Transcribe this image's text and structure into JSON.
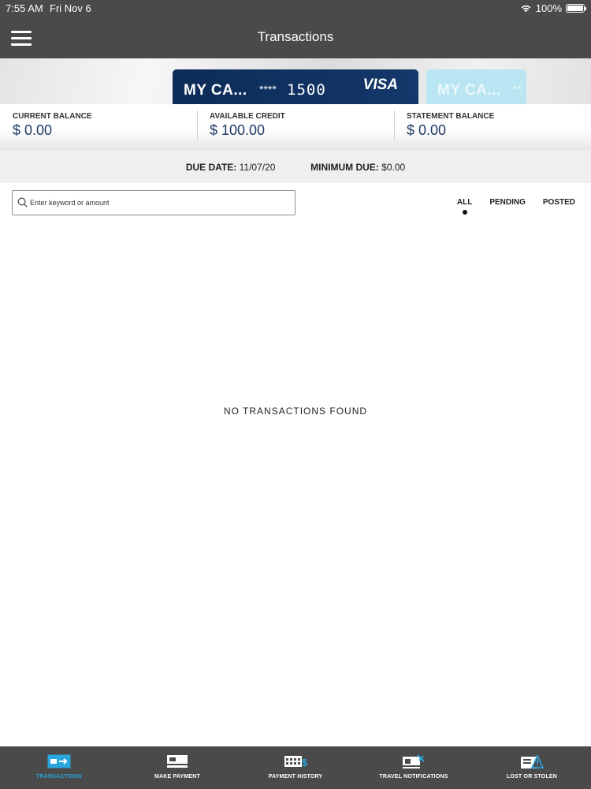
{
  "status_bar": {
    "time": "7:55 AM",
    "date": "Fri Nov 6",
    "battery": "100%"
  },
  "header": {
    "title": "Transactions"
  },
  "cards": [
    {
      "name": "MY CA...",
      "masked": "****",
      "last4": "1500",
      "brand": "VISA"
    },
    {
      "name": "MY CA...",
      "masked": "**"
    }
  ],
  "balances": [
    {
      "label": "CURRENT BALANCE",
      "value": "$ 0.00"
    },
    {
      "label": "AVAILABLE CREDIT",
      "value": "$ 100.00"
    },
    {
      "label": "STATEMENT BALANCE",
      "value": "$ 0.00"
    }
  ],
  "due": {
    "date_label": "DUE DATE:",
    "date_value": "11/07/20",
    "min_label": "MINIMUM DUE:",
    "min_value": "$0.00"
  },
  "search": {
    "placeholder": "Enter keyword or amount"
  },
  "filters": [
    "ALL",
    "PENDING",
    "POSTED"
  ],
  "empty_message": "NO TRANSACTIONS FOUND",
  "bottom_nav": [
    {
      "label": "TRANSACTIONS",
      "icon": "transactions-icon"
    },
    {
      "label": "MAKE PAYMENT",
      "icon": "card-icon"
    },
    {
      "label": "PAYMENT HISTORY",
      "icon": "payment-history-icon"
    },
    {
      "label": "TRAVEL NOTIFICATIONS",
      "icon": "travel-icon"
    },
    {
      "label": "LOST OR STOLEN",
      "icon": "lost-stolen-icon"
    }
  ],
  "colors": {
    "bar": "#4a4a4a",
    "card": "#0d2b57",
    "card_next": "#b9e6f2",
    "balance_value": "#1d3a66",
    "active_tab": "#2aa6df"
  }
}
